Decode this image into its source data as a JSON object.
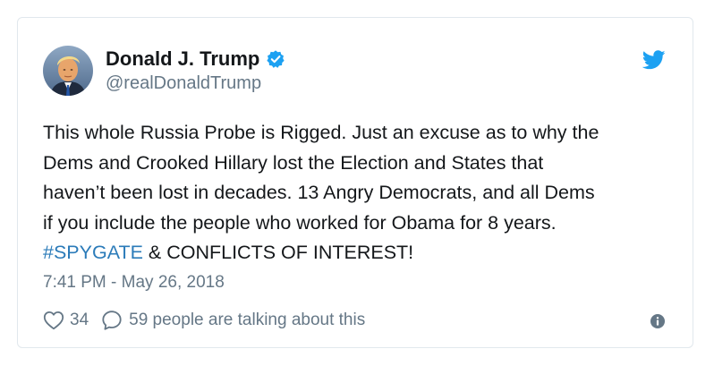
{
  "author": {
    "display_name": "Donald J. Trump",
    "handle": "@realDonaldTrump",
    "verified": true,
    "avatar_icon": "profile-photo"
  },
  "tweet": {
    "lines": [
      "This whole Russia Probe is Rigged. Just an excuse as to why the",
      "Dems and Crooked Hillary lost the Election and States that",
      "haven’t been lost in decades. 13 Angry Democrats, and all Dems",
      "if you include the people who worked for Obama for 8 years."
    ],
    "hashtag": "#SPYGATE",
    "last_line_rest": " & CONFLICTS OF INTEREST!"
  },
  "timestamp": "7:41 PM - May 26, 2018",
  "engagement": {
    "likes": "34",
    "talking": "59 people are talking about this"
  },
  "icons": {
    "brand": "twitter-bird-icon",
    "verified": "verified-badge-icon",
    "like": "heart-icon",
    "reply": "reply-bubble-icon",
    "info": "info-icon"
  },
  "colors": {
    "brand_blue": "#1da1f2",
    "hashtag_blue": "#2b7bb9",
    "muted_text": "#657786",
    "border": "#e1e8ed"
  }
}
